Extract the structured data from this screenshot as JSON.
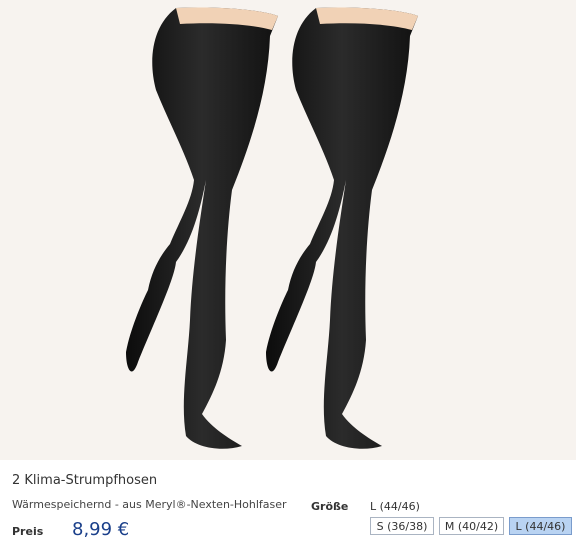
{
  "product": {
    "title": "2 Klima-Strumpfhosen",
    "subtitle": "Wärmespeichernd - aus Meryl®-Nexten-Hohlfaser",
    "price_label": "Preis",
    "price": "8,99 €"
  },
  "size": {
    "label": "Größe",
    "selected": "L (44/46)",
    "options": [
      {
        "label": "S (36/38)",
        "active": false
      },
      {
        "label": "M (40/42)",
        "active": false
      },
      {
        "label": "L (44/46)",
        "active": true
      }
    ]
  },
  "colors": {
    "background": "#f7f3ef",
    "hosiery": "#1a1a1a",
    "skin": "#f1d2b6",
    "price": "#1a3f8a",
    "active_option": "#b9d3f2"
  }
}
